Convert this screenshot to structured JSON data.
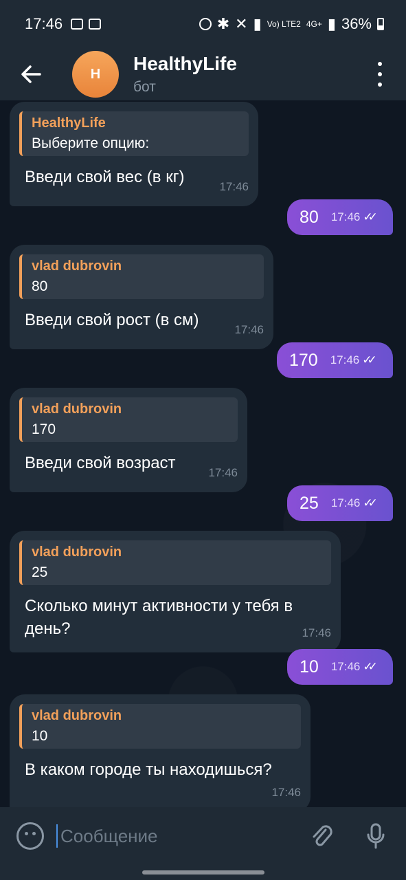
{
  "status_bar": {
    "time": "17:46",
    "battery": "36%",
    "icons": [
      "image-icon",
      "tasks-icon",
      "alarm-icon",
      "bluetooth-icon",
      "mute-icon",
      "signal-icon",
      "volte-icon",
      "4g-icon",
      "signal-icon",
      "battery-icon"
    ],
    "volte_label": "Vo) LTE2",
    "network_label": "4G+"
  },
  "header": {
    "avatar_letter": "H",
    "title": "HealthyLife",
    "subtitle": "бот"
  },
  "messages": [
    {
      "dir": "in",
      "reply_from": "HealthyLife",
      "reply_text": "Выберите опцию:",
      "text": "Введи свой вес (в кг)",
      "time": "17:46"
    },
    {
      "dir": "out",
      "text": "80",
      "time": "17:46"
    },
    {
      "dir": "in",
      "reply_from": "vlad dubrovin",
      "reply_text": "80",
      "text": "Введи свой рост (в см)",
      "time": "17:46"
    },
    {
      "dir": "out",
      "text": "170",
      "time": "17:46"
    },
    {
      "dir": "in",
      "reply_from": "vlad dubrovin",
      "reply_text": "170",
      "text": "Введи свой возраст",
      "time": "17:46"
    },
    {
      "dir": "out",
      "text": "25",
      "time": "17:46"
    },
    {
      "dir": "in",
      "reply_from": "vlad dubrovin",
      "reply_text": "25",
      "text": "Сколько минут активности у тебя в день?",
      "time": "17:46"
    },
    {
      "dir": "out",
      "text": "10",
      "time": "17:46"
    },
    {
      "dir": "in",
      "reply_from": "vlad dubrovin",
      "reply_text": "10",
      "text": "В каком городе ты находишься?",
      "time": "17:46"
    }
  ],
  "composer": {
    "placeholder": "Сообщение"
  },
  "colors": {
    "accent_orange": "#f2a05a",
    "outgoing_bubble": "#7b4ed1",
    "incoming_bubble": "#222e3a",
    "bar": "#1f2a35"
  }
}
